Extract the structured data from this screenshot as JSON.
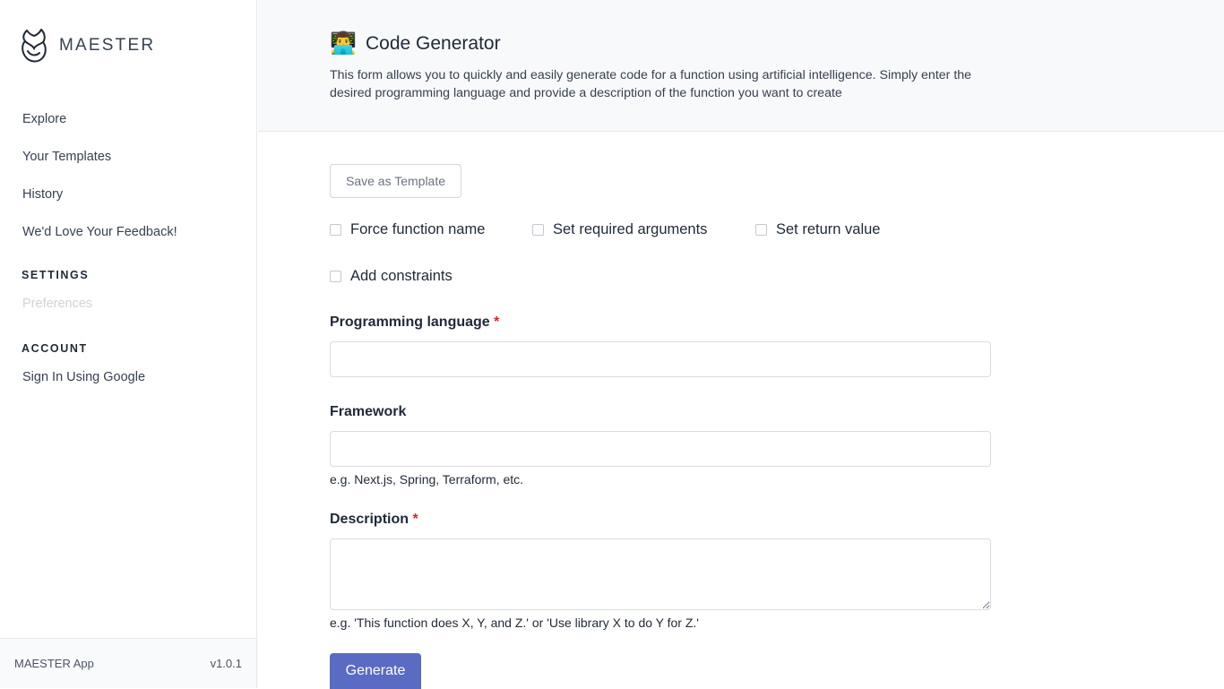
{
  "app": {
    "brand_name": "MAESTER",
    "logo_icon": "maester-owl-logo"
  },
  "sidebar": {
    "nav_items": [
      {
        "label": "Explore"
      },
      {
        "label": "Your Templates"
      },
      {
        "label": "History"
      },
      {
        "label": "We'd Love Your Feedback!"
      }
    ],
    "settings_heading": "SETTINGS",
    "preferences_label": "Preferences",
    "account_heading": "ACCOUNT",
    "sign_in_label": "Sign In Using Google",
    "footer": {
      "app_name": "MAESTER App",
      "version": "v1.0.1"
    }
  },
  "header": {
    "title_emoji": "👨‍💻",
    "title": "Code Generator",
    "description": "This form allows you to quickly and easily generate code for a function using artificial intelligence. Simply enter the desired programming language and provide a description of the function you want to create"
  },
  "form": {
    "save_template_label": "Save as Template",
    "options": [
      {
        "label": "Force function name",
        "checked": false
      },
      {
        "label": "Set required arguments",
        "checked": false
      },
      {
        "label": "Set return value",
        "checked": false
      },
      {
        "label": "Add constraints",
        "checked": false
      }
    ],
    "required_marker": "*",
    "language": {
      "label": "Programming language",
      "value": ""
    },
    "framework": {
      "label": "Framework",
      "value": "",
      "hint": "e.g. Next.js, Spring, Terraform, etc."
    },
    "description": {
      "label": "Description",
      "value": "",
      "hint": "e.g. 'This function does X, Y, and Z.' or 'Use library X to do Y for Z.'"
    },
    "generate_label": "Generate"
  },
  "colors": {
    "primary_button": "#5a6bc4",
    "required": "#dc2626",
    "header_bg": "#f8f9fb"
  }
}
